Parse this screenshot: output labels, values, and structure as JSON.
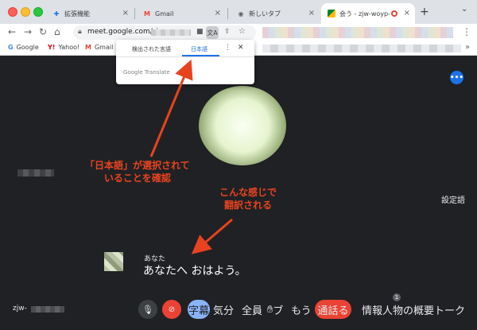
{
  "tabs": [
    {
      "label": "拡張機能",
      "icon": "puzzle-icon"
    },
    {
      "label": "Gmail",
      "icon": "gmail-icon"
    },
    {
      "label": "新しいタブ",
      "icon": "chrome-icon"
    },
    {
      "label": "会う - zjw-woyp-",
      "icon": "meet-icon",
      "active": true
    }
  ],
  "toolbar": {
    "url": "meet.google.com/zjw"
  },
  "bookmarks": [
    {
      "label": "Google",
      "icon_char": "G"
    },
    {
      "label": "Yahoo!",
      "icon_char": "Y!"
    },
    {
      "label": "Gmail",
      "icon_char": "M"
    }
  ],
  "translate_popup": {
    "tab_detected": "検出された言語",
    "tab_japanese": "日本語",
    "brand": "Google Translate"
  },
  "annotations": {
    "left_line1": "「日本語」が選択されて",
    "left_line2": "いることを確認",
    "right_line1": "こんな感じで",
    "right_line2": "翻訳される"
  },
  "meet": {
    "right_label": "設定語",
    "caption_speaker": "あなた",
    "caption_text": "あなたへ おはよう。",
    "me_name": "zjw-",
    "controls": {
      "captions_label": "字幕",
      "emoji_label": "気分",
      "present_label": "全員",
      "raise_label": "ブ",
      "more_label": "もう",
      "end_label": "通話る",
      "info_label": "情報人物の概要トーク",
      "participants_count": "1"
    }
  },
  "colors": {
    "accent_blue": "#1a73e8",
    "annotation_red": "#e8431e",
    "meet_bg": "#202124",
    "end_call_red": "#ea4335"
  }
}
